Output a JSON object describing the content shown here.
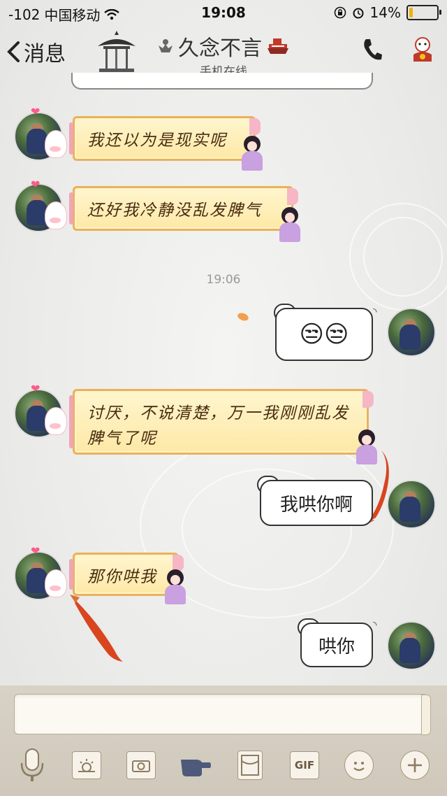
{
  "status_bar": {
    "signal": "-102",
    "carrier": "中国移动",
    "time": "19:08",
    "battery": "14%",
    "battery_level": 0.14,
    "icons": [
      "wifi-icon",
      "orientation-lock-icon",
      "alarm-icon",
      "battery-icon"
    ]
  },
  "header": {
    "back_label": "消息",
    "title": "久念不言",
    "subtitle": "手机在线",
    "icons": [
      "back-chevron-icon",
      "crown-icon",
      "ship-icon",
      "phone-icon",
      "profile-icon"
    ]
  },
  "chat": {
    "messages": [
      {
        "side": "left",
        "style": "scroll",
        "text": "我还以为是现实呢"
      },
      {
        "side": "left",
        "style": "scroll",
        "text": "还好我冷静没乱发脾气"
      },
      {
        "side": "right",
        "style": "ghost",
        "text": "😒😒"
      },
      {
        "side": "left",
        "style": "scroll",
        "text": "讨厌，不说清楚，万一我刚刚乱发脾气了呢"
      },
      {
        "side": "right",
        "style": "ghost",
        "text": "我哄你啊"
      },
      {
        "side": "left",
        "style": "scroll",
        "text": "那你哄我"
      },
      {
        "side": "right",
        "style": "ghost",
        "text": "哄你"
      }
    ],
    "timestamp": "19:06"
  },
  "input": {
    "value": "",
    "placeholder": ""
  },
  "toolbar": {
    "items": [
      "microphone-icon",
      "photo-album-icon",
      "camera-icon",
      "hand-icon",
      "red-packet-icon",
      "gif-icon",
      "emoji-icon",
      "plus-icon"
    ],
    "gif_label": "GIF"
  },
  "colors": {
    "scroll_bubble": "#fde8a6",
    "scroll_border": "#e9b25a",
    "ghost_bubble": "#ffffff",
    "text_dark": "#222222"
  }
}
